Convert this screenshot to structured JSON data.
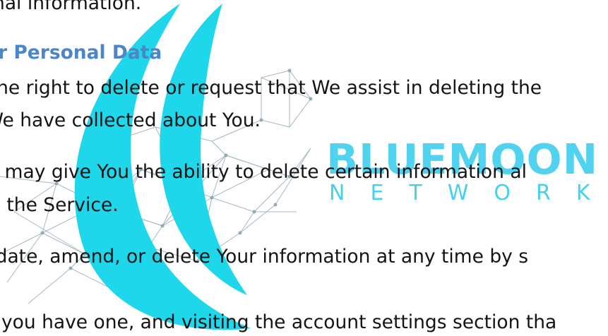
{
  "logo": {
    "wordmark_line1": "BLUEMOON",
    "wordmark_line2": "NETWORK",
    "primary_color": "#1ed7ea",
    "network_color": "#8aa7b2",
    "icon": "crescent-moon-network-logo"
  },
  "document": {
    "text_color": "#141414",
    "heading_color": "#4d86c6",
    "lines": [
      "sonal information.",
      "our Personal Data",
      "e the right to delete or request that We assist in deleting the",
      "t We have collected about You.",
      "ice may give You the ability to delete certain information al",
      "hin the Service.",
      "update, amend, or delete Your information at any time by s",
      ", if you have one, and visiting the account settings section tha"
    ]
  }
}
